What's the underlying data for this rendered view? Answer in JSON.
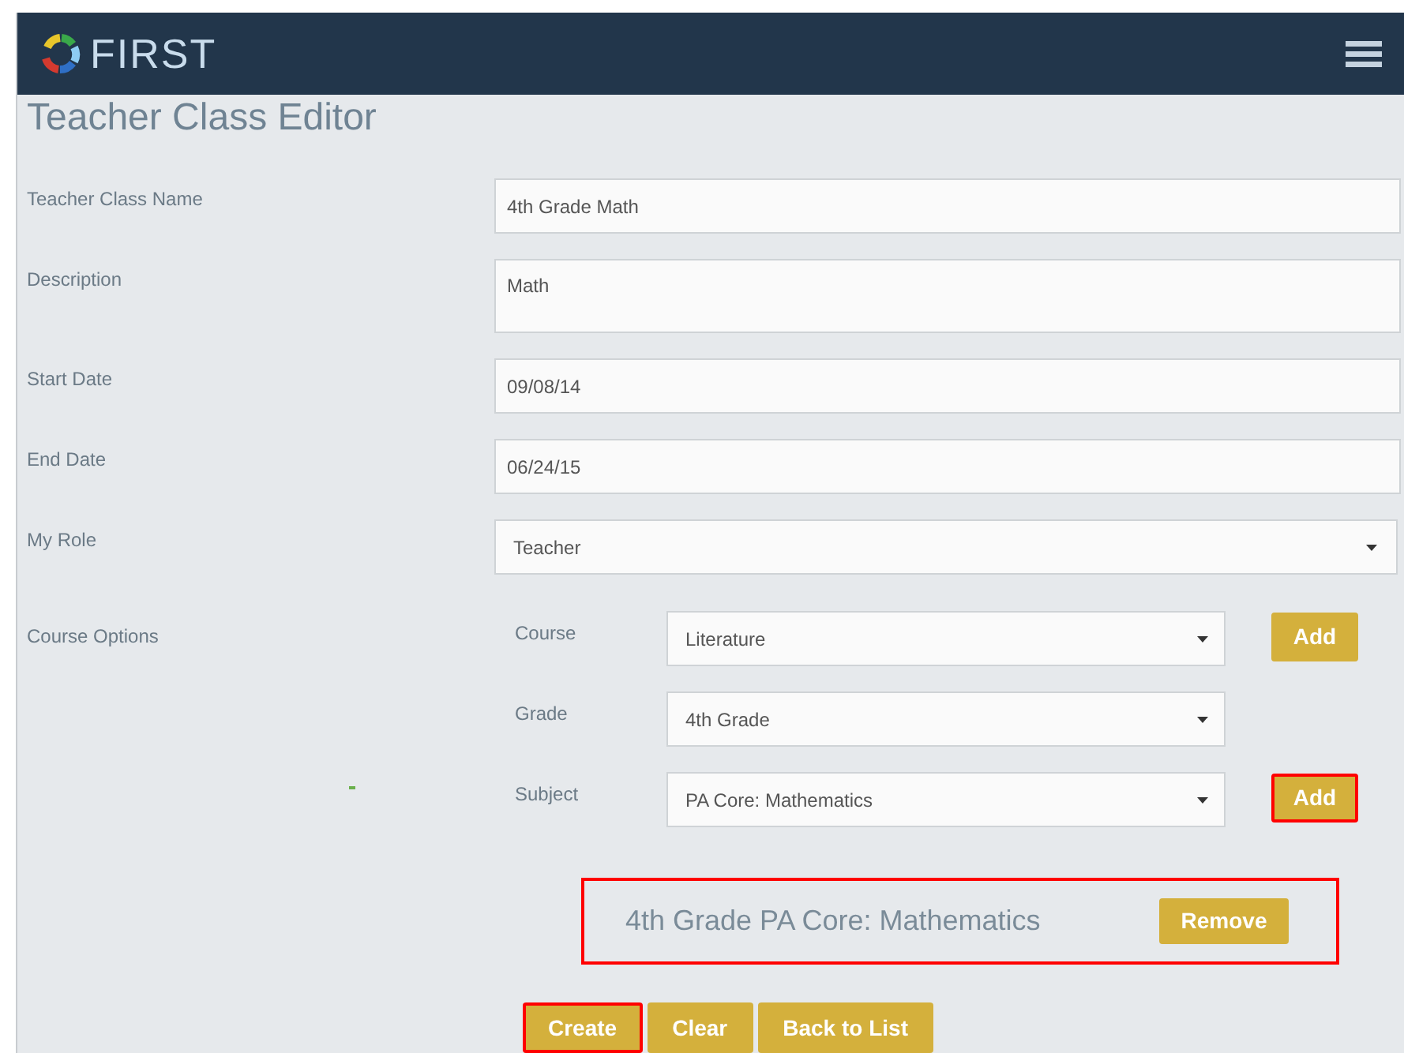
{
  "header": {
    "brand": "FIRST"
  },
  "page_title": "Teacher Class Editor",
  "fields": [
    {
      "label": "Teacher Class Name",
      "kind": "text",
      "value": "4th Grade Math"
    },
    {
      "label": "Description",
      "kind": "textarea",
      "value": "Math"
    },
    {
      "label": "Start Date",
      "kind": "text",
      "value": "09/08/14"
    },
    {
      "label": "End Date",
      "kind": "text",
      "value": "06/24/15"
    },
    {
      "label": "My Role",
      "kind": "select",
      "value": "Teacher"
    }
  ],
  "course_options": {
    "label": "Course Options",
    "rows": [
      {
        "label": "Course",
        "value": "Literature",
        "button": {
          "label": "Add",
          "highlighted": false
        }
      },
      {
        "label": "Grade",
        "value": "4th Grade"
      },
      {
        "label": "Subject",
        "value": "PA Core: Mathematics",
        "button": {
          "label": "Add",
          "highlighted": true
        }
      }
    ],
    "selected_courses": [
      {
        "name": "4th Grade PA Core: Mathematics",
        "button": "Remove",
        "highlighted": true
      }
    ]
  },
  "actions": [
    {
      "label": "Create",
      "highlighted": true
    },
    {
      "label": "Clear",
      "highlighted": false
    },
    {
      "label": "Back to List",
      "highlighted": false
    }
  ]
}
